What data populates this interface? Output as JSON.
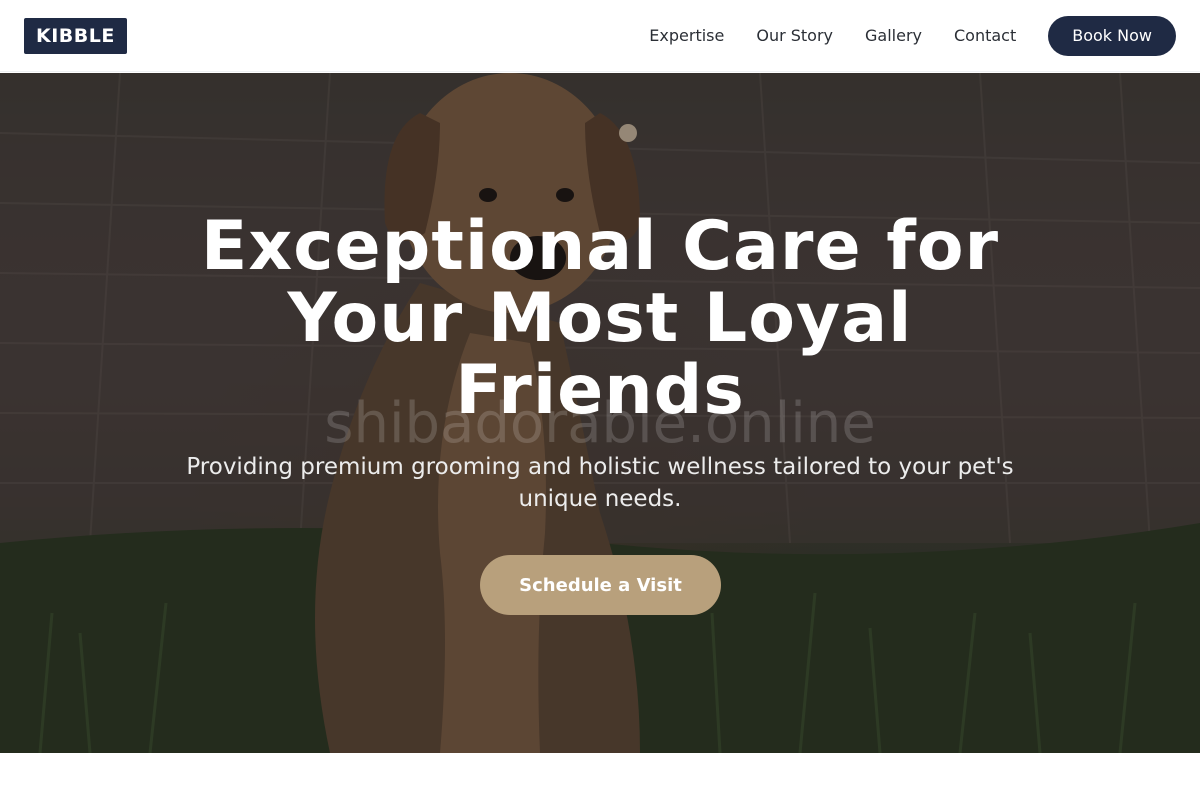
{
  "header": {
    "logo": "KIBBLE",
    "nav": [
      {
        "label": "Expertise"
      },
      {
        "label": "Our Story"
      },
      {
        "label": "Gallery"
      },
      {
        "label": "Contact"
      }
    ],
    "cta_label": "Book Now"
  },
  "hero": {
    "title": "Exceptional Care for Your Most Loyal Friends",
    "subtitle": "Providing premium grooming and holistic wellness tailored to your pet's unique needs.",
    "cta_label": "Schedule a Visit",
    "watermark": "shibadorable.online",
    "image_subject": "dog-sitting-on-grass"
  },
  "colors": {
    "brand_navy": "#1f2a44",
    "accent_tan": "#b8a07c",
    "text_white": "#ffffff"
  }
}
